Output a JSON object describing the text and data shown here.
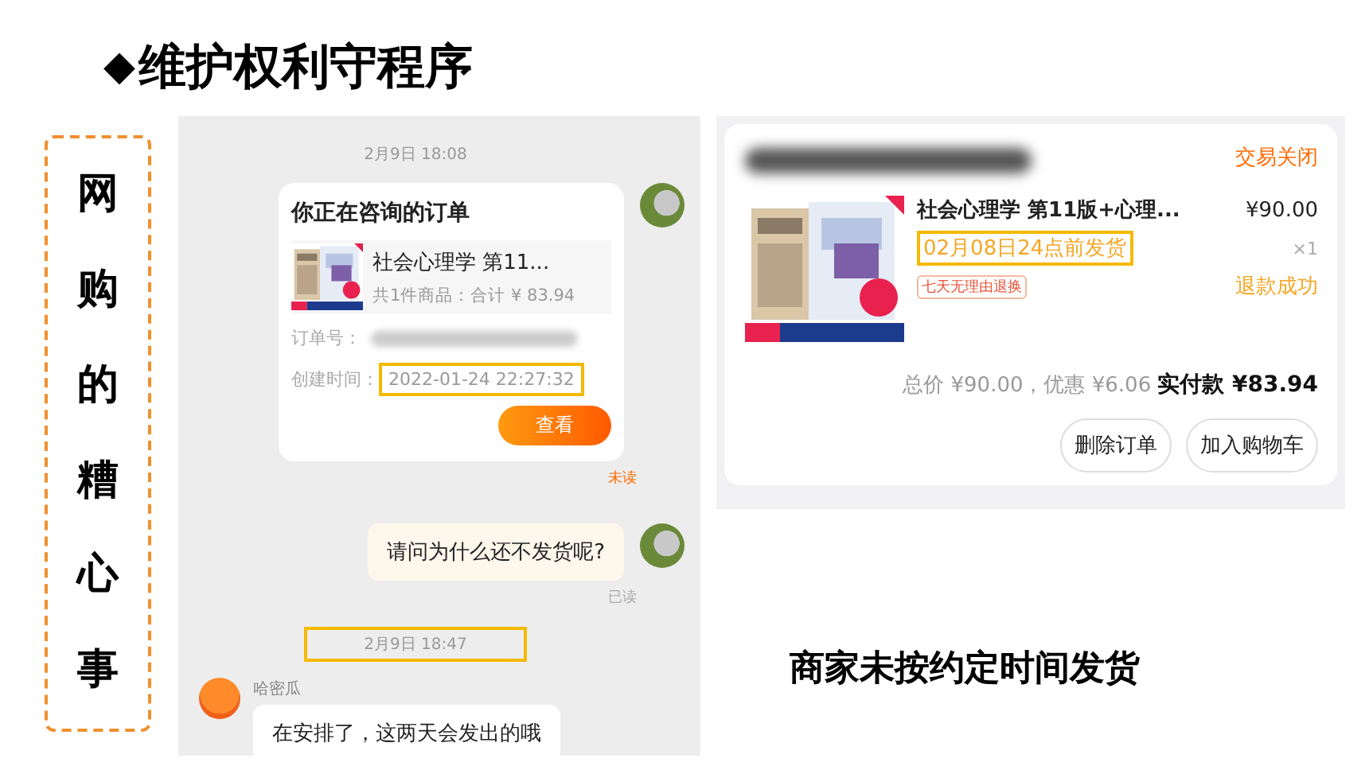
{
  "title": {
    "bullet": "◆",
    "text": "维护权利守程序"
  },
  "side_label": "网购的糟心事",
  "chat": {
    "messages": [
      {
        "kind": "timestamp",
        "text": "2月9日 18:08",
        "highlighted": false
      },
      {
        "kind": "order_card",
        "title": "你正在咨询的订单",
        "product": "社会心理学 第11...",
        "summary": "共1件商品：合计 ¥ 83.94",
        "order_no_label": "订单号：",
        "created_label": "创建时间：",
        "created": "2022-01-24 22:27:32",
        "created_highlighted": true,
        "button": "查看"
      },
      {
        "kind": "status",
        "text": "未读",
        "read": false
      },
      {
        "kind": "outgoing",
        "text": "请问为什么还不发货呢?"
      },
      {
        "kind": "status",
        "text": "已读",
        "read": true
      },
      {
        "kind": "timestamp",
        "text": "2月9日 18:47",
        "highlighted": true
      },
      {
        "kind": "incoming",
        "sender": "哈密瓜",
        "text": "在安排了，这两天会发出的哦"
      }
    ]
  },
  "order": {
    "status": "交易关闭",
    "title": "社会心理学 第11版+心理...",
    "price": "¥90.00",
    "ship_note": "02月08日24点前发货",
    "ship_note_highlighted": true,
    "quantity": "×1",
    "tag": "七天无理由退换",
    "refund": "退款成功",
    "total": "总价 ¥90.00，优惠 ¥6.06",
    "paid": "实付款 ¥83.94",
    "buttons": [
      "删除订单",
      "加入购物车"
    ]
  },
  "caption": "商家未按约定时间发货"
}
